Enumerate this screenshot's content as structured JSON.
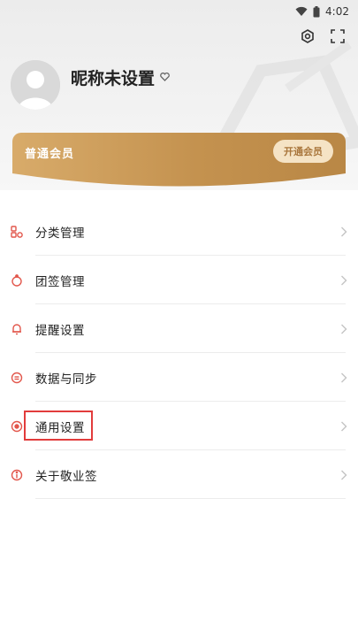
{
  "status_bar": {
    "time": "4:02"
  },
  "profile": {
    "nickname": "昵称未设置"
  },
  "vip": {
    "label": "普通会员",
    "button": "开通会员"
  },
  "menu": {
    "items": [
      {
        "label": "分类管理",
        "icon": "category-icon"
      },
      {
        "label": "团签管理",
        "icon": "group-tag-icon"
      },
      {
        "label": "提醒设置",
        "icon": "bell-icon"
      },
      {
        "label": "数据与同步",
        "icon": "sync-icon"
      },
      {
        "label": "通用设置",
        "icon": "settings-dot-icon"
      },
      {
        "label": "关于敬业签",
        "icon": "info-icon"
      }
    ]
  },
  "colors": {
    "accent_red": "#e2574c",
    "vip_gold": "#c7954f",
    "highlight": "#e23c3c"
  }
}
